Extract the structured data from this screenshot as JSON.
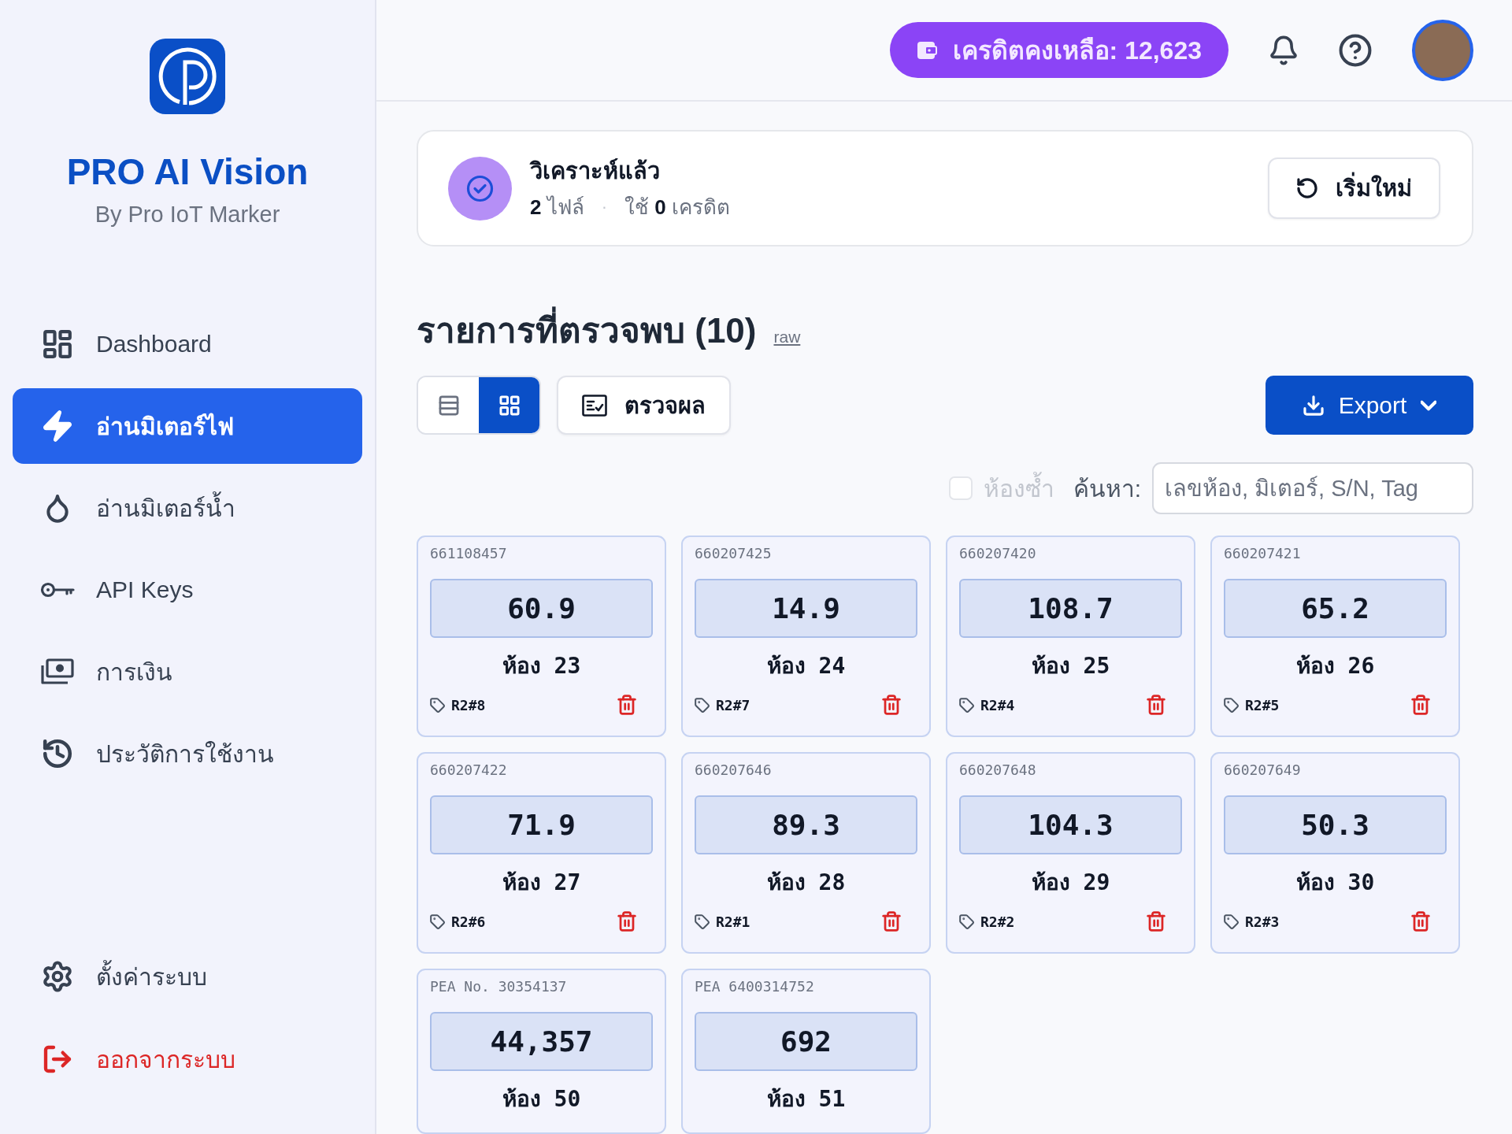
{
  "sidebar": {
    "brand": {
      "title": "PRO AI Vision",
      "subtitle": "By Pro IoT Marker"
    },
    "nav": [
      {
        "label": "Dashboard",
        "selected": false
      },
      {
        "label": "อ่านมิเตอร์ไฟ",
        "selected": true
      },
      {
        "label": "อ่านมิเตอร์น้ำ",
        "selected": false
      },
      {
        "label": "API Keys",
        "selected": false
      },
      {
        "label": "การเงิน",
        "selected": false
      },
      {
        "label": "ประวัติการใช้งาน",
        "selected": false
      }
    ],
    "footer_nav": [
      {
        "label": "ตั้งค่าระบบ",
        "kind": "default",
        "selected": false
      },
      {
        "label": "ออกจากระบบ",
        "kind": "danger",
        "selected": false
      }
    ]
  },
  "topbar": {
    "credit_badge": "เครดิตคงเหลือ: 12,623"
  },
  "status": {
    "title": "วิเคราะห์แล้ว",
    "files": "**2** ไฟล์",
    "separator": "·",
    "credits": "ใช้ **0** เครดิต",
    "restart_button": "เริ่มใหม่"
  },
  "results": {
    "heading": "รายการที่ตรวจพบ (10)",
    "raw_link": "raw",
    "view_toggle": [
      {
        "kind": "list",
        "selected": false
      },
      {
        "kind": "grid",
        "selected": true
      }
    ],
    "review_button": "ตรวจผล",
    "export_button": "Export",
    "duplicate_filter": {
      "label": "ห้องซ้ำ",
      "checked": false,
      "disabled": true
    },
    "search": {
      "label": "ค้นหา:",
      "placeholder": "เลขห้อง, มิเตอร์, S/N, Tag"
    },
    "cards": [
      {
        "serial": "661108457",
        "reading": "60.9",
        "room": "ห้อง 23",
        "tag": "R2#8"
      },
      {
        "serial": "660207425",
        "reading": "14.9",
        "room": "ห้อง 24",
        "tag": "R2#7"
      },
      {
        "serial": "660207420",
        "reading": "108.7",
        "room": "ห้อง 25",
        "tag": "R2#4"
      },
      {
        "serial": "660207421",
        "reading": "65.2",
        "room": "ห้อง 26",
        "tag": "R2#5"
      },
      {
        "serial": "660207422",
        "reading": "71.9",
        "room": "ห้อง 27",
        "tag": "R2#6"
      },
      {
        "serial": "660207646",
        "reading": "89.3",
        "room": "ห้อง 28",
        "tag": "R2#1"
      },
      {
        "serial": "660207648",
        "reading": "104.3",
        "room": "ห้อง 29",
        "tag": "R2#2"
      },
      {
        "serial": "660207649",
        "reading": "50.3",
        "room": "ห้อง 30",
        "tag": "R2#3"
      },
      {
        "serial": "PEA No. 30354137",
        "reading": "44,357",
        "room": "ห้อง 50"
      },
      {
        "serial": "PEA 6400314752",
        "reading": "692",
        "room": "ห้อง 51"
      }
    ]
  }
}
